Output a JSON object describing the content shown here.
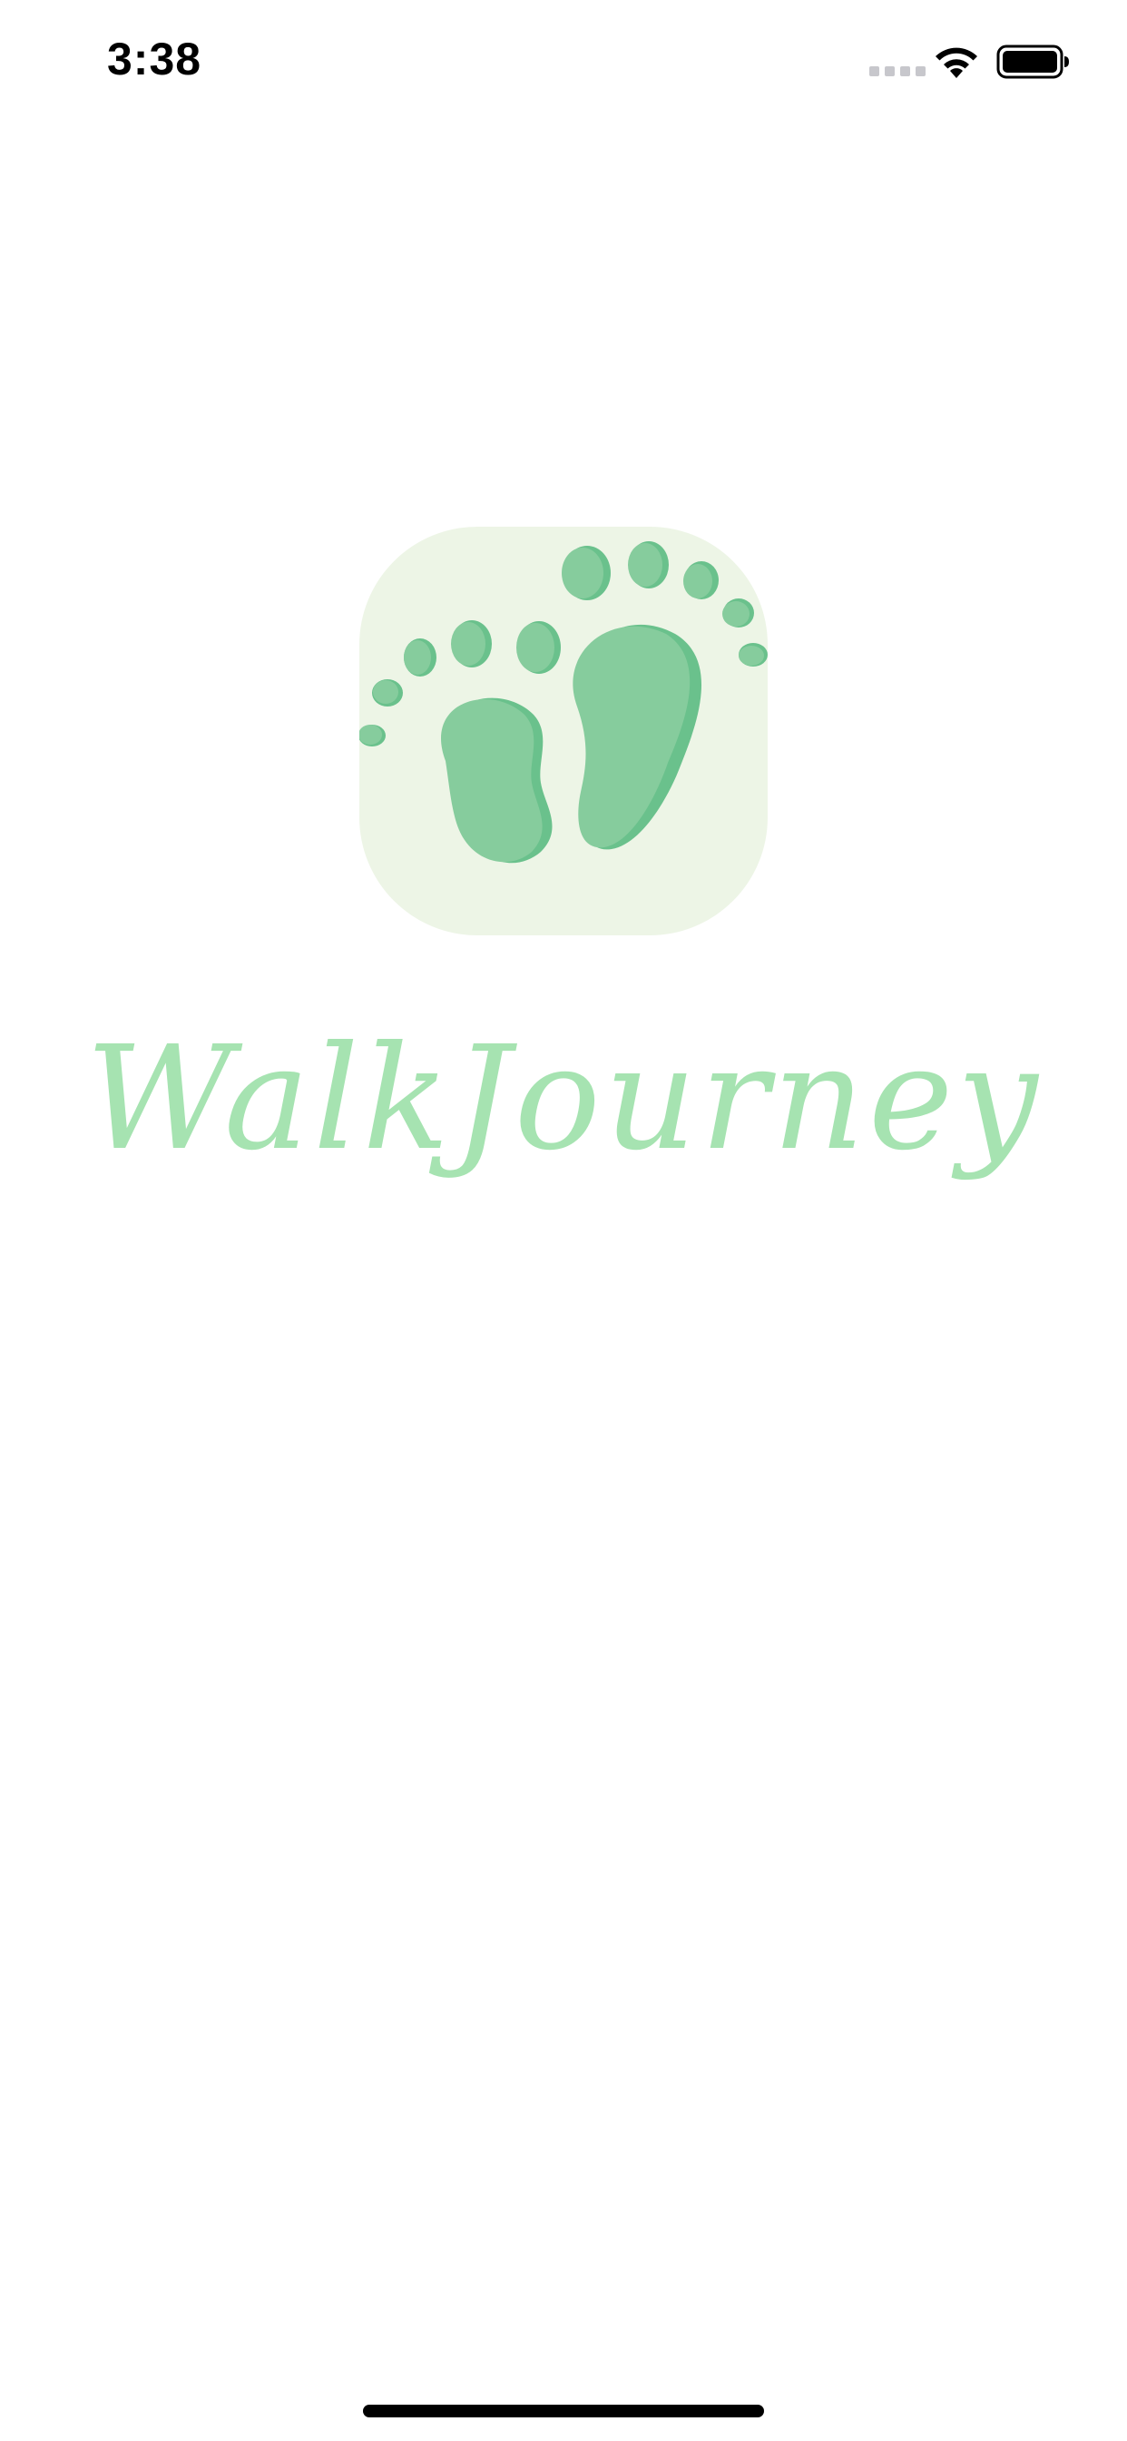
{
  "status_bar": {
    "time": "3:38",
    "icons": [
      "cellular-signal-icon",
      "wifi-icon",
      "battery-icon"
    ]
  },
  "splash": {
    "app_name": "WalkJourney",
    "logo_icon": "footprints-icon"
  },
  "colors": {
    "background": "#ffffff",
    "icon_background": "#edf5e6",
    "foot_light": "#86cc9d",
    "foot_dark": "#6ac18c",
    "app_name": "#a6e3b1"
  }
}
